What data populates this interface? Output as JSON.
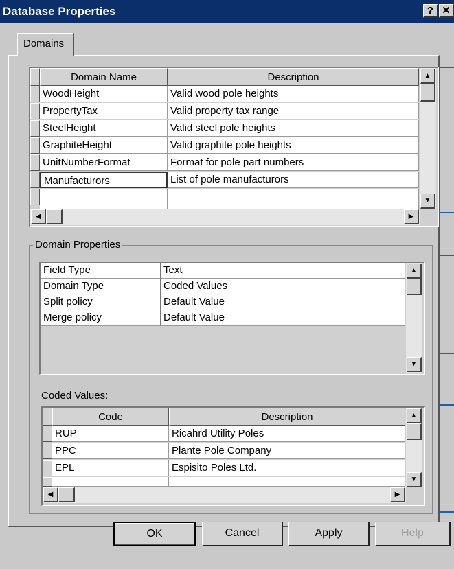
{
  "window": {
    "title": "Database Properties",
    "help_glyph": "?",
    "close_glyph": "✕"
  },
  "tabs": [
    {
      "label": "Domains"
    }
  ],
  "domains_table": {
    "columns": [
      "Domain Name",
      "Description"
    ],
    "rows": [
      {
        "name": "WoodHeight",
        "description": "Valid wood pole heights"
      },
      {
        "name": "PropertyTax",
        "description": "Valid property tax range"
      },
      {
        "name": "SteelHeight",
        "description": "Valid steel pole heights"
      },
      {
        "name": "GraphiteHeight",
        "description": "Valid graphite pole heights"
      },
      {
        "name": "UnitNumberFormat",
        "description": "Format for pole part numbers"
      },
      {
        "name": "Manufacturors",
        "description": "List of pole manufacturors"
      }
    ],
    "selected_row": 5
  },
  "domain_properties": {
    "label": "Domain Properties",
    "rows": [
      {
        "property": "Field Type",
        "value": "Text"
      },
      {
        "property": "Domain Type",
        "value": "Coded Values"
      },
      {
        "property": "Split policy",
        "value": "Default Value"
      },
      {
        "property": "Merge policy",
        "value": "Default Value"
      }
    ]
  },
  "coded_values": {
    "label": "Coded Values:",
    "columns": [
      "Code",
      "Description"
    ],
    "rows": [
      {
        "code": "RUP",
        "description": "Ricahrd Utility Poles"
      },
      {
        "code": "PPC",
        "description": "Plante Pole Company"
      },
      {
        "code": "EPL",
        "description": "Espisito Poles Ltd."
      }
    ]
  },
  "buttons": {
    "ok": "OK",
    "cancel": "Cancel",
    "apply": "Apply",
    "help": "Help"
  },
  "icons": {
    "scroll_up": "scroll-up-arrow-icon",
    "scroll_down": "scroll-down-arrow-icon",
    "scroll_left": "scroll-left-arrow-icon",
    "scroll_right": "scroll-right-arrow-icon"
  },
  "colors": {
    "title_bar": "#0a2f6b",
    "callout_line": "#1f5fa8",
    "dialog_bg": "#c9c9c9"
  }
}
